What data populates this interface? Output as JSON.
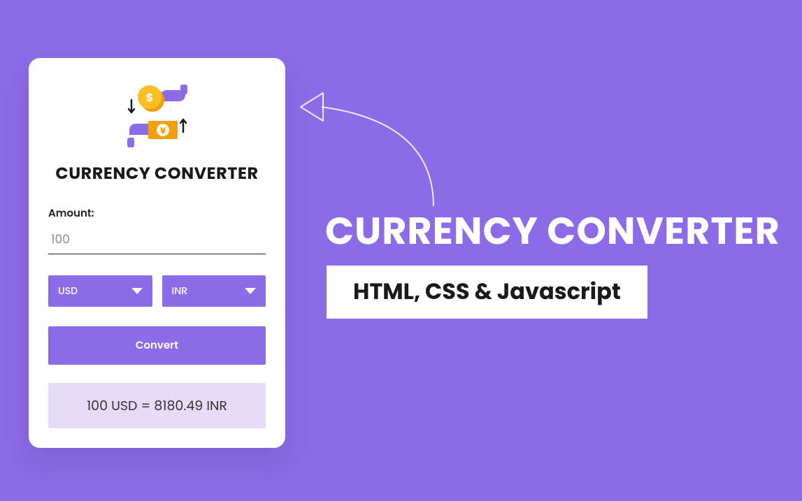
{
  "card": {
    "title": "CURRENCY CONVERTER",
    "amount_label": "Amount:",
    "amount_value": "100",
    "from_currency": "USD",
    "to_currency": "INR",
    "convert_label": "Convert",
    "result_text": "100 USD = 8180.49 INR"
  },
  "headline": "CURRENCY CONVERTER",
  "subheadline": "HTML, CSS & Javascript",
  "icons": {
    "exchange": "currency-exchange-icon",
    "chevron_down": "chevron-down-icon"
  },
  "colors": {
    "background": "#8c6be8",
    "card_bg": "#ffffff",
    "result_bg": "#e6dcfa",
    "accent": "#8c6be8"
  }
}
